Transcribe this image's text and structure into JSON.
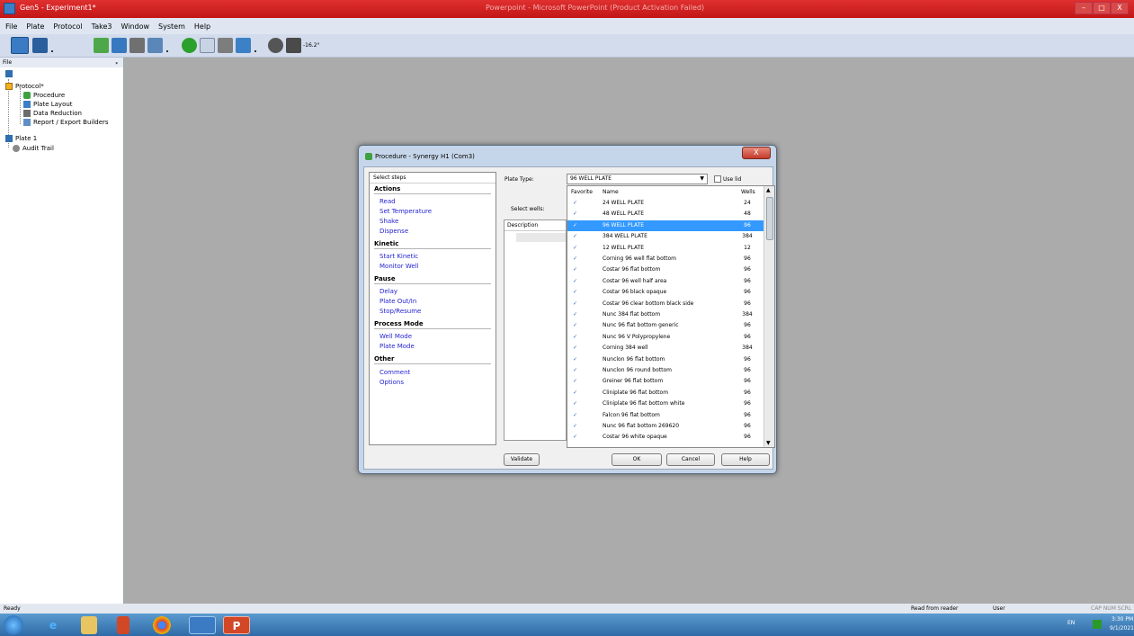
{
  "window": {
    "title": "Gen5 - Experiment1*",
    "center_title": "Powerpoint - Microsoft PowerPoint (Product Activation Failed)",
    "minimize": "–",
    "maximize": "□",
    "close": "X"
  },
  "menu": [
    "File",
    "Plate",
    "Protocol",
    "Take3",
    "Window",
    "System",
    "Help"
  ],
  "toolbar": {
    "temp": "-16.2°"
  },
  "left_panel": {
    "header": "File",
    "pin": "ᵩ",
    "tree": [
      "Protocol*",
      "Procedure",
      "Plate Layout",
      "Data Reduction",
      "Report / Export Builders",
      "Plate 1",
      "Audit Trail"
    ]
  },
  "dialog": {
    "title": "Procedure - Synergy H1 (Com3)",
    "close": "X",
    "steps_header": "Select steps",
    "sections": [
      {
        "title": "Actions",
        "items": [
          "Read",
          "Set Temperature",
          "Shake",
          "Dispense"
        ]
      },
      {
        "title": "Kinetic",
        "items": [
          "Start Kinetic",
          "Monitor Well"
        ]
      },
      {
        "title": "Pause",
        "items": [
          "Delay",
          "Plate Out/In",
          "Stop/Resume"
        ]
      },
      {
        "title": "Process Mode",
        "items": [
          "Well Mode",
          "Plate Mode"
        ]
      },
      {
        "title": "Other",
        "items": [
          "Comment",
          "Options"
        ]
      }
    ],
    "plate_type_label": "Plate Type:",
    "plate_type_value": "96 WELL PLATE",
    "use_lid": "Use lid",
    "select_wells": "Select wells:",
    "description_header": "Description",
    "list_headers": {
      "favorite": "Favorite",
      "name": "Name",
      "wells": "Wells"
    },
    "plates": [
      {
        "name": "24 WELL PLATE",
        "wells": "24"
      },
      {
        "name": "48 WELL PLATE",
        "wells": "48"
      },
      {
        "name": "96 WELL PLATE",
        "wells": "96"
      },
      {
        "name": "384 WELL PLATE",
        "wells": "384"
      },
      {
        "name": "12 WELL PLATE",
        "wells": "12"
      },
      {
        "name": "Corning 96 well flat bottom",
        "wells": "96"
      },
      {
        "name": "Costar 96 flat bottom",
        "wells": "96"
      },
      {
        "name": "Costar 96 well half area",
        "wells": "96"
      },
      {
        "name": "Costar 96 black opaque",
        "wells": "96"
      },
      {
        "name": "Costar 96 clear bottom black side",
        "wells": "96"
      },
      {
        "name": "Nunc 384 flat bottom",
        "wells": "384"
      },
      {
        "name": "Nunc 96 flat bottom generic",
        "wells": "96"
      },
      {
        "name": "Nunc 96 V Polypropylene",
        "wells": "96"
      },
      {
        "name": "Corning 384 well",
        "wells": "384"
      },
      {
        "name": "Nunclon 96 flat bottom",
        "wells": "96"
      },
      {
        "name": "Nunclon 96 round bottom",
        "wells": "96"
      },
      {
        "name": "Greiner 96 flat bottom",
        "wells": "96"
      },
      {
        "name": "Cliniplate 96 flat bottom",
        "wells": "96"
      },
      {
        "name": "Cliniplate 96 flat bottom white",
        "wells": "96"
      },
      {
        "name": "Falcon 96 flat bottom",
        "wells": "96"
      },
      {
        "name": "Nunc 96 flat bottom 269620",
        "wells": "96"
      },
      {
        "name": "Costar 96 white opaque",
        "wells": "96"
      }
    ],
    "check_mark": "✓",
    "buttons": {
      "validate": "Validate",
      "ok": "OK",
      "cancel": "Cancel",
      "help": "Help"
    }
  },
  "status": {
    "ready": "Ready",
    "read_from_reader": "Read from reader",
    "user": "User",
    "caps": "CAP NUM SCRL"
  },
  "taskbar": {
    "lang": "EN",
    "time": "3:30 PM",
    "date": "9/1/2021"
  },
  "colors": {
    "title_bar": "#c21616",
    "selection": "#3399ff",
    "link": "#1f1fd1"
  }
}
